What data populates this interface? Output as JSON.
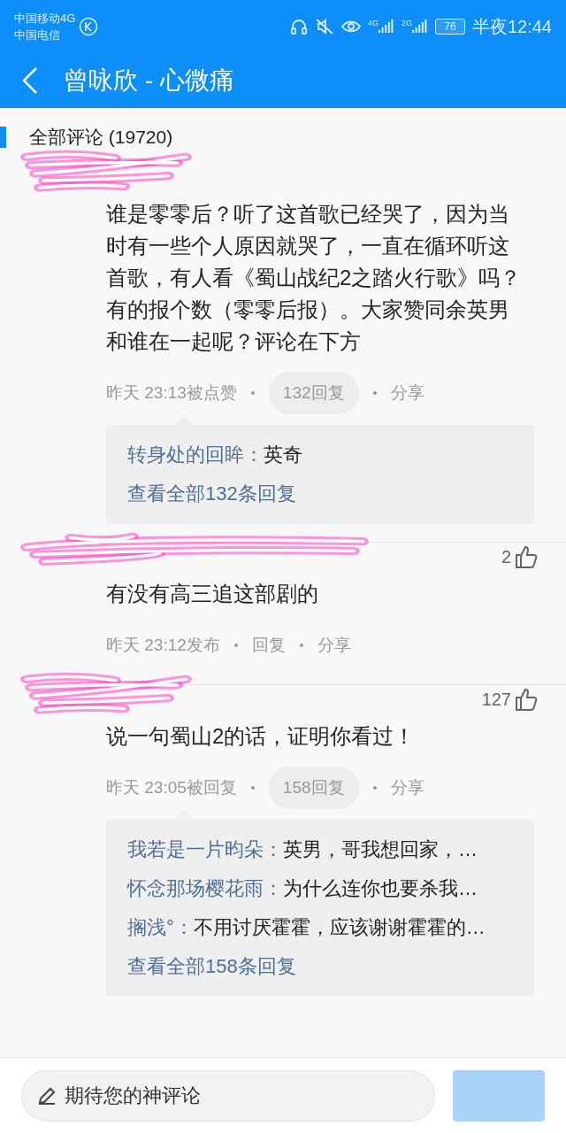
{
  "status_bar": {
    "carriers": [
      "中国移动4G",
      "中国电信"
    ],
    "signals": [
      "4G",
      "2G"
    ],
    "battery": "76",
    "time": "半夜12:44"
  },
  "header": {
    "title": "曾咏欣 - 心微痛"
  },
  "section": {
    "title": "全部评论 (19720)"
  },
  "comments": [
    {
      "text": "谁是零零后？听了这首歌已经哭了，因为当时有一些个人原因就哭了，一直在循环听这首歌，有人看《蜀山战纪2之踏火行歌》吗？有的报个数（零零后报）。大家赞同余英男和谁在一起呢？评论在下方",
      "meta": [
        {
          "kind": "time",
          "text": "昨天 23:13被点赞"
        },
        {
          "kind": "pill",
          "text": "132回复"
        },
        {
          "kind": "link",
          "text": "分享"
        }
      ],
      "replies": [
        {
          "user": "转身处的回眸：",
          "text": "英奇"
        }
      ],
      "more": "查看全部132条回复"
    },
    {
      "likes": "2",
      "text": "有没有高三追这部剧的",
      "meta": [
        {
          "kind": "time",
          "text": "昨天 23:12发布"
        },
        {
          "kind": "link",
          "text": "回复"
        },
        {
          "kind": "link",
          "text": "分享"
        }
      ]
    },
    {
      "likes": "127",
      "text": "说一句蜀山2的话，证明你看过！",
      "meta": [
        {
          "kind": "time",
          "text": "昨天 23:05被回复"
        },
        {
          "kind": "pill",
          "text": "158回复"
        },
        {
          "kind": "link",
          "text": "分享"
        }
      ],
      "replies": [
        {
          "user": "我若是一片昀朵：",
          "text": "英男，哥我想回家，…"
        },
        {
          "user": "怀念那场樱花雨：",
          "text": "为什么连你也要杀我…"
        },
        {
          "user": "搁浅°：",
          "text": "不用讨厌霍霍，应该谢谢霍霍的…"
        }
      ],
      "more": "查看全部158条回复"
    }
  ],
  "composer": {
    "placeholder": "期待您的神评论"
  }
}
